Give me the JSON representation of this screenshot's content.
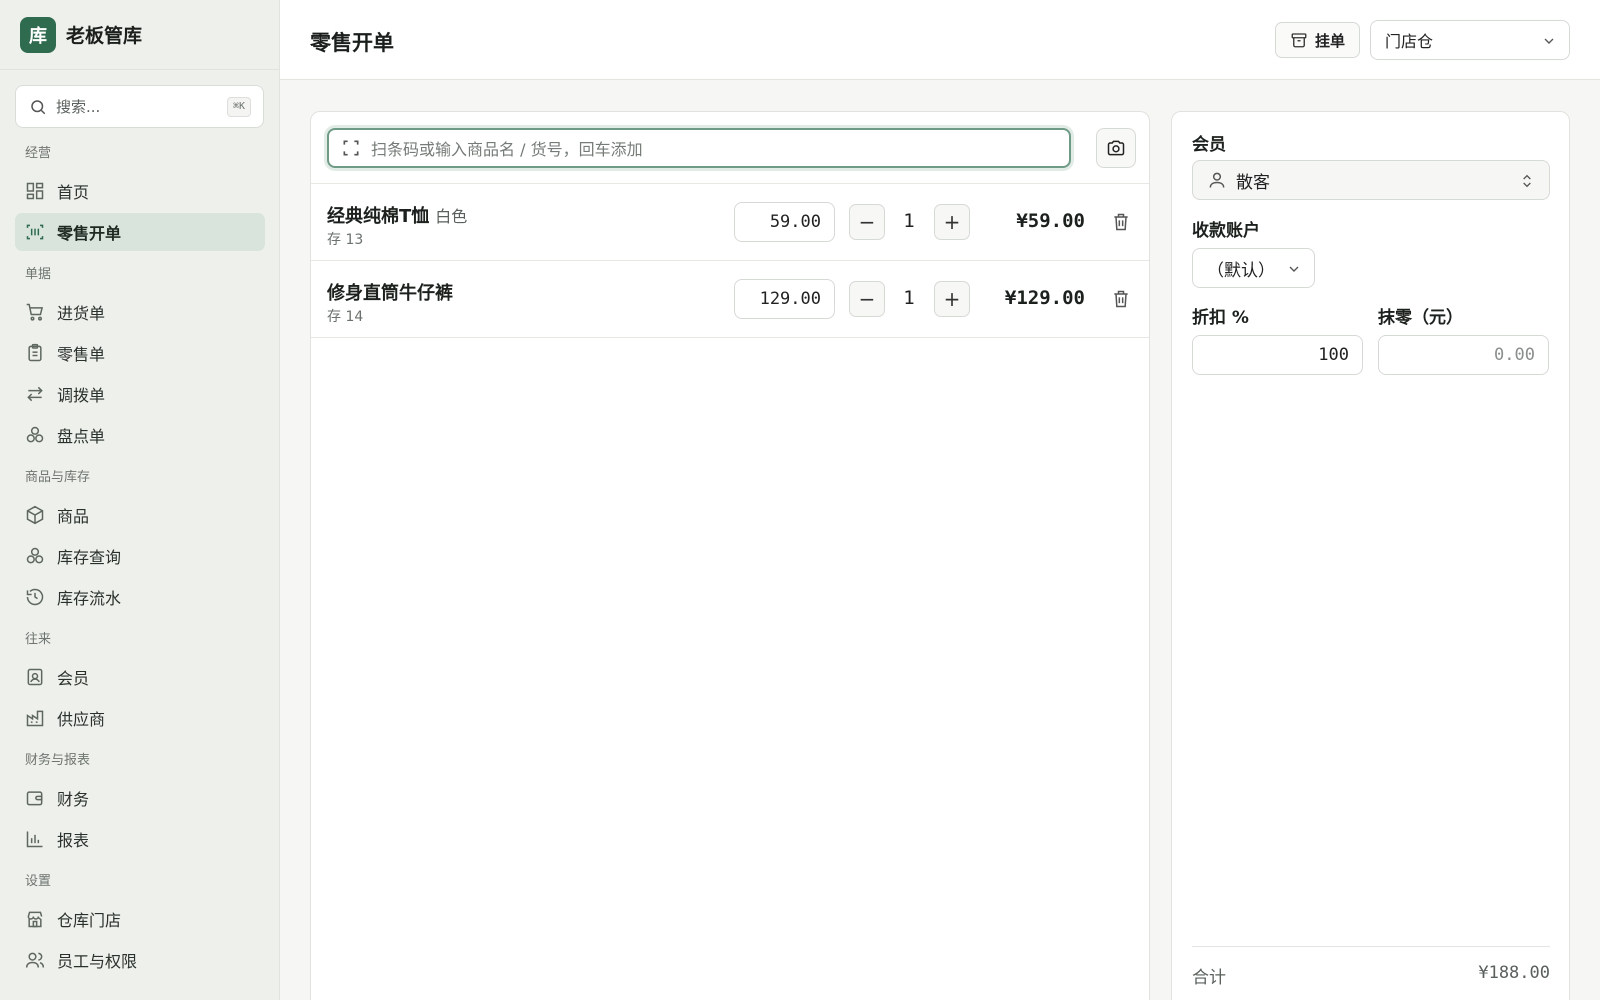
{
  "brand": {
    "logo_char": "库",
    "name": "老板管库"
  },
  "search": {
    "placeholder": "搜索...",
    "shortcut": "⌘K"
  },
  "sidebar": {
    "groups": [
      {
        "title": "经营",
        "items": [
          {
            "label": "首页",
            "icon": "grid-icon"
          },
          {
            "label": "零售开单",
            "icon": "scan-icon",
            "active": true
          }
        ]
      },
      {
        "title": "单据",
        "items": [
          {
            "label": "进货单",
            "icon": "cart-icon"
          },
          {
            "label": "零售单",
            "icon": "clipboard-icon"
          },
          {
            "label": "调拨单",
            "icon": "transfer-icon"
          },
          {
            "label": "盘点单",
            "icon": "boxes-icon"
          }
        ]
      },
      {
        "title": "商品与库存",
        "items": [
          {
            "label": "商品",
            "icon": "package-icon"
          },
          {
            "label": "库存查询",
            "icon": "boxes-icon"
          },
          {
            "label": "库存流水",
            "icon": "history-icon"
          }
        ]
      },
      {
        "title": "往来",
        "items": [
          {
            "label": "会员",
            "icon": "contact-icon"
          },
          {
            "label": "供应商",
            "icon": "factory-icon"
          }
        ]
      },
      {
        "title": "财务与报表",
        "items": [
          {
            "label": "财务",
            "icon": "wallet-icon"
          },
          {
            "label": "报表",
            "icon": "bar-chart-icon"
          }
        ]
      },
      {
        "title": "设置",
        "items": [
          {
            "label": "仓库门店",
            "icon": "store-icon"
          },
          {
            "label": "员工与权限",
            "icon": "users-icon"
          }
        ]
      }
    ]
  },
  "header": {
    "title": "零售开单",
    "hold_label": "挂单",
    "warehouse": "门店仓"
  },
  "cart": {
    "scan_placeholder": "扫条码或输入商品名 / 货号，回车添加",
    "lines": [
      {
        "name": "经典纯棉T恤",
        "variant": "白色",
        "stock": "存 13",
        "price": "59.00",
        "qty": "1",
        "amount": "¥59.00"
      },
      {
        "name": "修身直筒牛仔裤",
        "variant": "",
        "stock": "存 14",
        "price": "129.00",
        "qty": "1",
        "amount": "¥129.00"
      }
    ]
  },
  "summary": {
    "member_label": "会员",
    "member_value": "散客",
    "account_label": "收款账户",
    "account_value": "（默认）",
    "discount_label": "折扣 %",
    "discount_value": "100",
    "rounding_label": "抹零（元）",
    "rounding_placeholder": "0.00",
    "total_label": "合计",
    "total_value": "¥188.00"
  },
  "colors": {
    "accent": "#2f6b4f",
    "active_bg": "#d9e4dd",
    "focus_ring": "#6f9a86"
  }
}
